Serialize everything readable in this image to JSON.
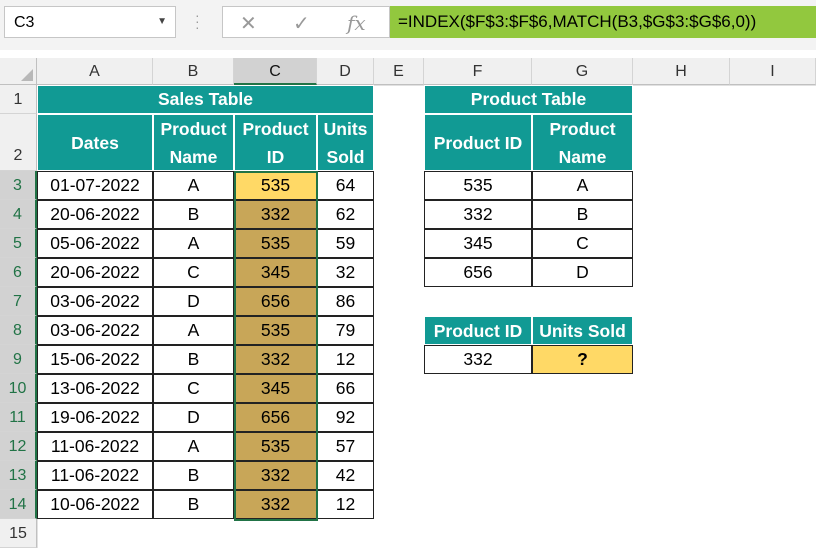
{
  "name_box": "C3",
  "formula": "=INDEX($F$3:$F$6,MATCH(B3,$G$3:$G$6,0))",
  "fx_label": "fx",
  "columns": [
    "A",
    "B",
    "C",
    "D",
    "E",
    "F",
    "G",
    "H",
    "I"
  ],
  "rows": [
    "1",
    "2",
    "3",
    "4",
    "5",
    "6",
    "7",
    "8",
    "9",
    "10",
    "11",
    "12",
    "13",
    "14",
    "15"
  ],
  "sales": {
    "title": "Sales Table",
    "headers": [
      "Dates",
      "Product Name",
      "Product ID",
      "Units Sold"
    ],
    "data": [
      [
        "01-07-2022",
        "A",
        "535",
        "64"
      ],
      [
        "20-06-2022",
        "B",
        "332",
        "62"
      ],
      [
        "05-06-2022",
        "A",
        "535",
        "59"
      ],
      [
        "20-06-2022",
        "C",
        "345",
        "32"
      ],
      [
        "03-06-2022",
        "D",
        "656",
        "86"
      ],
      [
        "03-06-2022",
        "A",
        "535",
        "79"
      ],
      [
        "15-06-2022",
        "B",
        "332",
        "12"
      ],
      [
        "13-06-2022",
        "C",
        "345",
        "66"
      ],
      [
        "19-06-2022",
        "D",
        "656",
        "92"
      ],
      [
        "11-06-2022",
        "A",
        "535",
        "57"
      ],
      [
        "11-06-2022",
        "B",
        "332",
        "42"
      ],
      [
        "10-06-2022",
        "B",
        "332",
        "12"
      ]
    ]
  },
  "product": {
    "title": "Product Table",
    "headers": [
      "Product ID",
      "Product Name"
    ],
    "data": [
      [
        "535",
        "A"
      ],
      [
        "332",
        "B"
      ],
      [
        "345",
        "C"
      ],
      [
        "656",
        "D"
      ]
    ]
  },
  "lookup": {
    "headers": [
      "Product ID",
      "Units Sold"
    ],
    "values": [
      "332",
      "?"
    ]
  },
  "colors": {
    "teal": "#119a94",
    "tan": "#c8a658",
    "yellow": "#ffd966",
    "formula_bar": "#92c83e",
    "selection": "#217346"
  }
}
